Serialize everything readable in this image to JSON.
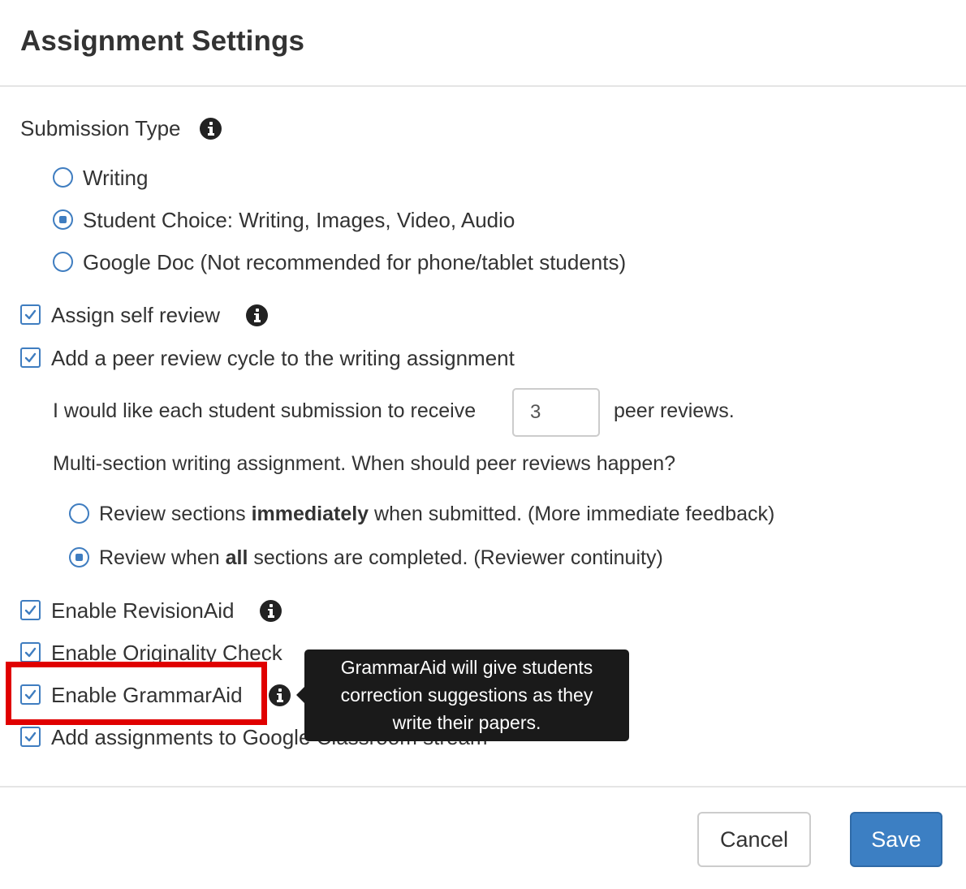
{
  "dialog": {
    "title": "Assignment Settings"
  },
  "submission_type": {
    "label": "Submission Type",
    "options": [
      {
        "label": "Writing",
        "selected": false
      },
      {
        "label": "Student Choice: Writing, Images, Video, Audio",
        "selected": true
      },
      {
        "label": "Google Doc (Not recommended for phone/tablet students)",
        "selected": false
      }
    ]
  },
  "self_review": {
    "label": "Assign self review",
    "checked": true
  },
  "peer_review": {
    "label": "Add a peer review cycle to the writing assignment",
    "checked": true,
    "count_prefix": "I would like each student submission to receive",
    "count_value": "3",
    "count_suffix": "peer reviews.",
    "multi_section_question": "Multi-section writing assignment. When should peer reviews happen?",
    "timing_options": [
      {
        "pre": "Review sections ",
        "bold": "immediately",
        "post": " when submitted. (More immediate feedback)",
        "selected": false
      },
      {
        "pre": "Review when ",
        "bold": "all",
        "post": " sections are completed. (Reviewer continuity)",
        "selected": true
      }
    ]
  },
  "revision_aid": {
    "label": "Enable RevisionAid",
    "checked": true
  },
  "originality_check": {
    "label": "Enable Originality Check",
    "checked": true
  },
  "grammar_aid": {
    "label": "Enable GrammarAid",
    "checked": true,
    "tooltip_lines": [
      "GrammarAid will give students",
      "correction suggestions as they",
      "write their papers."
    ]
  },
  "google_classroom": {
    "label": "Add assignments to Google Classroom stream",
    "checked": true
  },
  "footer": {
    "cancel_label": "Cancel",
    "save_label": "Save"
  },
  "colors": {
    "accent": "#3f7dc0",
    "save_button": "#3c7fc3",
    "highlight": "#e00000",
    "tooltip_bg": "#1a1a1a"
  },
  "icons": [
    "info-icon",
    "checkbox-checked-icon",
    "radio-icon"
  ]
}
